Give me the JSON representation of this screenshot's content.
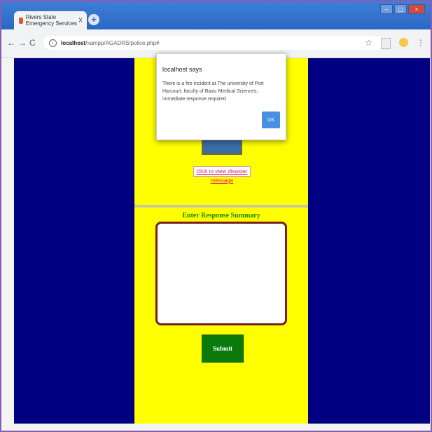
{
  "browser": {
    "tab_title": "Rivers State Emergency Services",
    "tab_close": "X",
    "new_tab": "+",
    "url_host": "localhost",
    "url_path": "/xampp/AGADRS/police.php#",
    "window_buttons": [
      "–",
      "▢",
      "×"
    ]
  },
  "page": {
    "link_text": "click to view disaster message",
    "summary_title": "Enter Response Summary",
    "textarea_value": "",
    "submit_label": "Submit"
  },
  "dialog": {
    "title": "localhost says",
    "message": "There is a fire incident at The university of Port Harcourt, faculty of Basic Medical Sciences; immediate response required",
    "ok_label": "OK"
  },
  "colors": {
    "page_bg": "#000080",
    "panel_bg": "#ffff00",
    "submit_bg": "#0a7a0a",
    "accent_blue": "#4a90e2"
  }
}
